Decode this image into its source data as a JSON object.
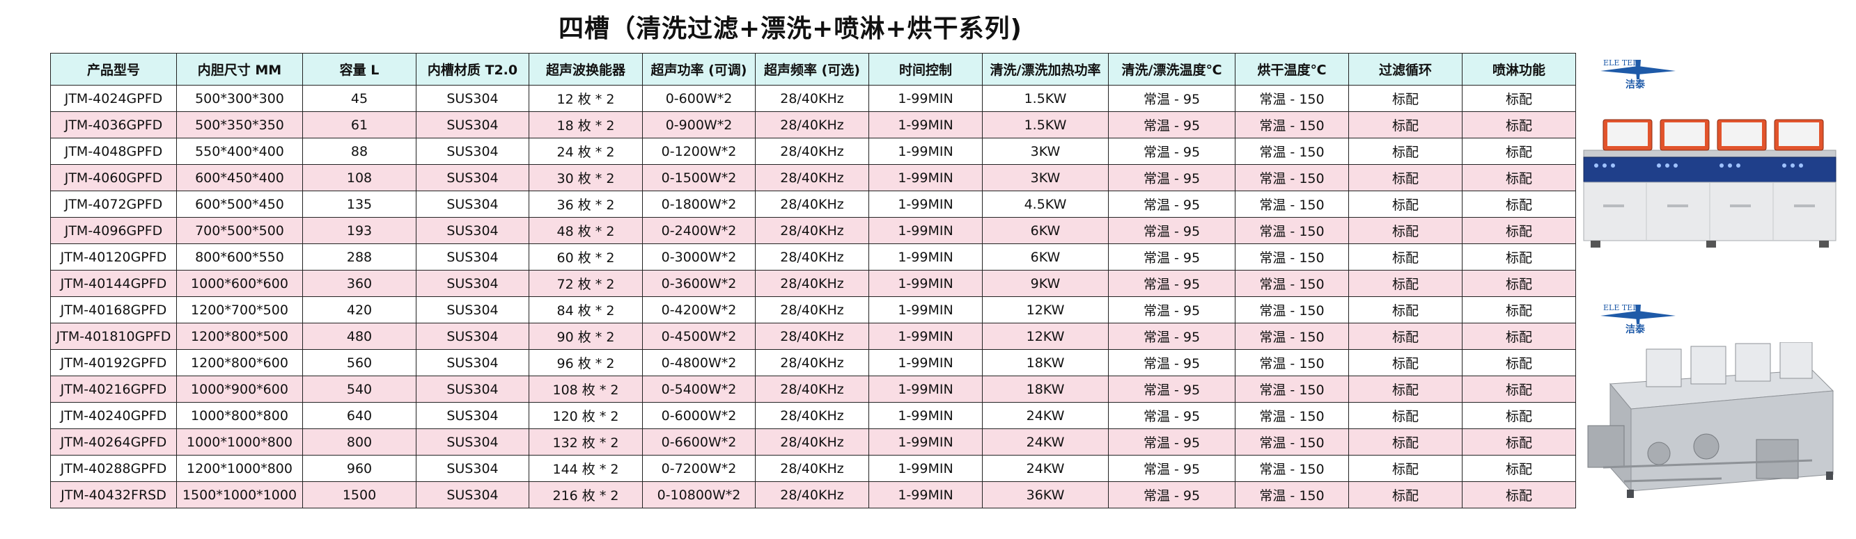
{
  "title": "四槽（清洗过滤+漂洗+喷淋+烘干系列)",
  "headers": [
    "产品型号",
    "内胆尺寸 MM",
    "容量 L",
    "内槽材质 T2.0",
    "超声波换能器",
    "超声功率 (可调)",
    "超声频率 (可选)",
    "时间控制",
    "清洗/漂洗加热功率",
    "清洗/漂洗温度℃",
    "烘干温度℃",
    "过滤循环",
    "喷淋功能"
  ],
  "rows": [
    [
      "JTM-4024GPFD",
      "500*300*300",
      "45",
      "SUS304",
      "12 枚 * 2",
      "0-600W*2",
      "28/40KHz",
      "1-99MIN",
      "1.5KW",
      "常温 - 95",
      "常温 - 150",
      "标配",
      "标配"
    ],
    [
      "JTM-4036GPFD",
      "500*350*350",
      "61",
      "SUS304",
      "18 枚 * 2",
      "0-900W*2",
      "28/40KHz",
      "1-99MIN",
      "1.5KW",
      "常温 - 95",
      "常温 - 150",
      "标配",
      "标配"
    ],
    [
      "JTM-4048GPFD",
      "550*400*400",
      "88",
      "SUS304",
      "24 枚 * 2",
      "0-1200W*2",
      "28/40KHz",
      "1-99MIN",
      "3KW",
      "常温 - 95",
      "常温 - 150",
      "标配",
      "标配"
    ],
    [
      "JTM-4060GPFD",
      "600*450*400",
      "108",
      "SUS304",
      "30 枚 * 2",
      "0-1500W*2",
      "28/40KHz",
      "1-99MIN",
      "3KW",
      "常温 - 95",
      "常温 - 150",
      "标配",
      "标配"
    ],
    [
      "JTM-4072GPFD",
      "600*500*450",
      "135",
      "SUS304",
      "36 枚 * 2",
      "0-1800W*2",
      "28/40KHz",
      "1-99MIN",
      "4.5KW",
      "常温 - 95",
      "常温 - 150",
      "标配",
      "标配"
    ],
    [
      "JTM-4096GPFD",
      "700*500*500",
      "193",
      "SUS304",
      "48 枚 * 2",
      "0-2400W*2",
      "28/40KHz",
      "1-99MIN",
      "6KW",
      "常温 - 95",
      "常温 - 150",
      "标配",
      "标配"
    ],
    [
      "JTM-40120GPFD",
      "800*600*550",
      "288",
      "SUS304",
      "60 枚 * 2",
      "0-3000W*2",
      "28/40KHz",
      "1-99MIN",
      "6KW",
      "常温 - 95",
      "常温 - 150",
      "标配",
      "标配"
    ],
    [
      "JTM-40144GPFD",
      "1000*600*600",
      "360",
      "SUS304",
      "72 枚 * 2",
      "0-3600W*2",
      "28/40KHz",
      "1-99MIN",
      "9KW",
      "常温 - 95",
      "常温 - 150",
      "标配",
      "标配"
    ],
    [
      "JTM-40168GPFD",
      "1200*700*500",
      "420",
      "SUS304",
      "84 枚 * 2",
      "0-4200W*2",
      "28/40KHz",
      "1-99MIN",
      "12KW",
      "常温 - 95",
      "常温 - 150",
      "标配",
      "标配"
    ],
    [
      "JTM-401810GPFD",
      "1200*800*500",
      "480",
      "SUS304",
      "90 枚 * 2",
      "0-4500W*2",
      "28/40KHz",
      "1-99MIN",
      "12KW",
      "常温 - 95",
      "常温 - 150",
      "标配",
      "标配"
    ],
    [
      "JTM-40192GPFD",
      "1200*800*600",
      "560",
      "SUS304",
      "96 枚 * 2",
      "0-4800W*2",
      "28/40KHz",
      "1-99MIN",
      "18KW",
      "常温 - 95",
      "常温 - 150",
      "标配",
      "标配"
    ],
    [
      "JTM-40216GPFD",
      "1000*900*600",
      "540",
      "SUS304",
      "108 枚 * 2",
      "0-5400W*2",
      "28/40KHz",
      "1-99MIN",
      "18KW",
      "常温 - 95",
      "常温 - 150",
      "标配",
      "标配"
    ],
    [
      "JTM-40240GPFD",
      "1000*800*800",
      "640",
      "SUS304",
      "120 枚 * 2",
      "0-6000W*2",
      "28/40KHz",
      "1-99MIN",
      "24KW",
      "常温 - 95",
      "常温 - 150",
      "标配",
      "标配"
    ],
    [
      "JTM-40264GPFD",
      "1000*1000*800",
      "800",
      "SUS304",
      "132 枚 * 2",
      "0-6600W*2",
      "28/40KHz",
      "1-99MIN",
      "24KW",
      "常温 - 95",
      "常温 - 150",
      "标配",
      "标配"
    ],
    [
      "JTM-40288GPFD",
      "1200*1000*800",
      "960",
      "SUS304",
      "144 枚 * 2",
      "0-7200W*2",
      "28/40KHz",
      "1-99MIN",
      "24KW",
      "常温 - 95",
      "常温 - 150",
      "标配",
      "标配"
    ],
    [
      "JTM-40432FRSD",
      "1500*1000*1000",
      "1500",
      "SUS304",
      "216 枚 * 2",
      "0-10800W*2",
      "28/40KHz",
      "1-99MIN",
      "36KW",
      "常温 - 95",
      "常温 - 150",
      "标配",
      "标配"
    ]
  ],
  "colors": {
    "header_bg": "#d9f5f4",
    "row_even_bg": "#f9dde4",
    "row_odd_bg": "#ffffff",
    "logo_blue": "#1e5aa8"
  },
  "side_panel": {
    "logo_text": "洁泰",
    "logo_mark_text": "ELE TEL",
    "images": [
      "product-photo-enclosed-machine",
      "product-photo-open-frame-machine"
    ]
  }
}
